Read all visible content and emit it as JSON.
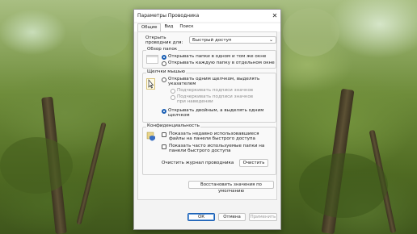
{
  "window": {
    "title": "Параметры Проводника"
  },
  "tabs": [
    "Общие",
    "Вид",
    "Поиск"
  ],
  "open_explorer": {
    "label": "Открыть проводник для:",
    "value": "Быстрый доступ"
  },
  "browse_folders": {
    "title": "Обзор папок",
    "options": [
      "Открывать папки в одном и том же окне",
      "Открывать каждую папку в отдельном окне"
    ],
    "selected": 0
  },
  "mouse_clicks": {
    "title": "Щелчки мышью",
    "option_single": "Открывать одним щелчком, выделять указателем",
    "sub_options": [
      "Подчеркивать подписи значков",
      "Подчеркивать подписи значков при наведении"
    ],
    "option_double": "Открывать двойным, а выделять одним щелчком",
    "selected": "double"
  },
  "privacy": {
    "title": "Конфиденциальность",
    "check_recent": "Показать недавно использовавшиеся файлы на панели быстрого доступа",
    "check_frequent": "Показать часто используемые папки на панели быстрого доступа",
    "clear_label": "Очистить журнал проводника",
    "clear_button": "Очистить"
  },
  "restore_button": "Восстановить значения по умолчанию",
  "footer": {
    "ok": "ОК",
    "cancel": "Отмена",
    "apply": "Применить"
  }
}
